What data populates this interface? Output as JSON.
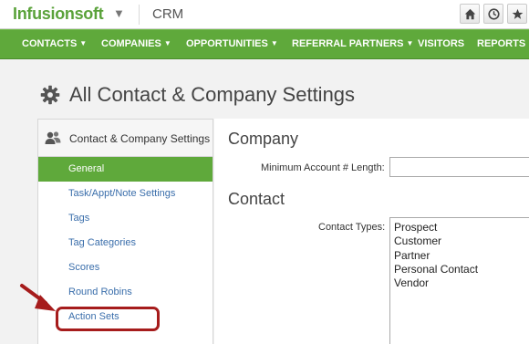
{
  "topbar": {
    "logo": "Infusionsoft",
    "app_name": "CRM",
    "icons": [
      "home-icon",
      "clock-icon",
      "star-icon"
    ]
  },
  "nav": {
    "items": [
      {
        "label": "CONTACTS",
        "has_dropdown": true
      },
      {
        "label": "COMPANIES",
        "has_dropdown": true
      },
      {
        "label": "OPPORTUNITIES",
        "has_dropdown": true
      },
      {
        "label": "REFERRAL PARTNERS",
        "has_dropdown": true
      },
      {
        "label": "VISITORS",
        "has_dropdown": false
      },
      {
        "label": "REPORTS",
        "has_dropdown": true
      }
    ]
  },
  "page": {
    "title": "All Contact & Company Settings"
  },
  "sidebar": {
    "heading": "Contact & Company Settings",
    "items": [
      {
        "label": "General",
        "active": true
      },
      {
        "label": "Task/Appt/Note Settings",
        "active": false
      },
      {
        "label": "Tags",
        "active": false
      },
      {
        "label": "Tag Categories",
        "active": false
      },
      {
        "label": "Scores",
        "active": false
      },
      {
        "label": "Round Robins",
        "active": false
      },
      {
        "label": "Action Sets",
        "active": false,
        "highlighted": true
      }
    ]
  },
  "main": {
    "company_section": {
      "title": "Company",
      "min_account_label": "Minimum Account # Length:",
      "min_account_value": ""
    },
    "contact_section": {
      "title": "Contact",
      "contact_types_label": "Contact Types:",
      "contact_types": [
        "Prospect",
        "Customer",
        "Partner",
        "Personal Contact",
        "Vendor"
      ]
    }
  },
  "colors": {
    "brand_green": "#5fa93b",
    "link_blue": "#3a6eab",
    "annotation_red": "#a61c1c"
  }
}
